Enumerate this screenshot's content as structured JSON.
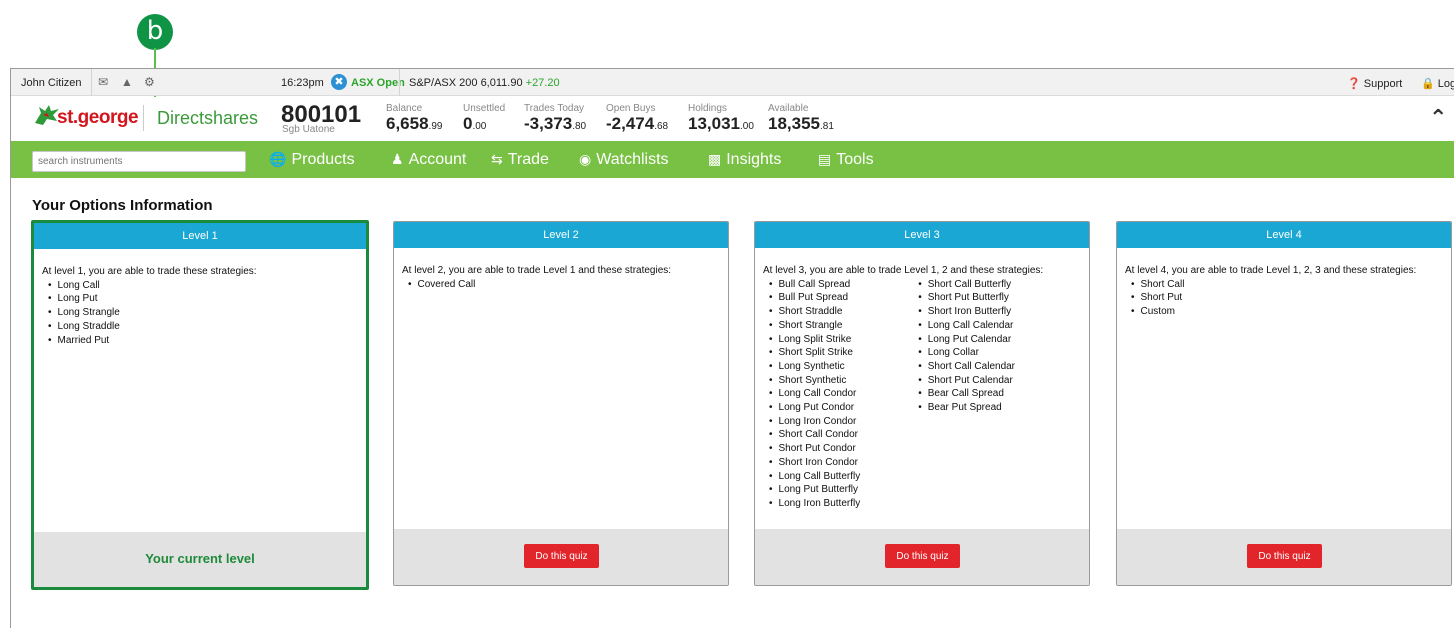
{
  "callout": {
    "label": "b"
  },
  "statusbar": {
    "user": "John Citizen",
    "time": "16:23pm",
    "market_status": "ASX Open",
    "index_name": "S&P/ASX 200",
    "index_value": "6,011.90",
    "index_change": "+27.20",
    "support": "Support",
    "logout": "Log out"
  },
  "header": {
    "brand": "st.george",
    "product": "Directshares",
    "account_number": "800101",
    "account_name": "Sgb Uatone",
    "stats": [
      {
        "label": "Balance",
        "value": "6,658",
        "dec": ".99"
      },
      {
        "label": "Unsettled",
        "value": "0",
        "dec": ".00"
      },
      {
        "label": "Trades Today",
        "value": "-3,373",
        "dec": ".80"
      },
      {
        "label": "Open Buys",
        "value": "-2,474",
        "dec": ".68"
      },
      {
        "label": "Holdings",
        "value": "13,031",
        "dec": ".00"
      },
      {
        "label": "Available",
        "value": "18,355",
        "dec": ".81"
      }
    ]
  },
  "nav": {
    "search_placeholder": "search instruments",
    "items": [
      {
        "label": "Products",
        "icon": "globe-icon"
      },
      {
        "label": "Account",
        "icon": "user-icon"
      },
      {
        "label": "Trade",
        "icon": "retweet-icon"
      },
      {
        "label": "Watchlists",
        "icon": "binoculars-icon"
      },
      {
        "label": "Insights",
        "icon": "monitor-icon"
      },
      {
        "label": "Tools",
        "icon": "bar-chart-icon"
      }
    ]
  },
  "page": {
    "title": "Your Options Information"
  },
  "levels": [
    {
      "title": "Level 1",
      "intro": "At level 1, you are able to trade these strategies:",
      "col1": [
        "Long Call",
        "Long Put",
        "Long Strangle",
        "Long Straddle",
        "Married Put"
      ],
      "col2": [],
      "footer": "Your current level"
    },
    {
      "title": "Level 2",
      "intro": "At level 2, you are able to trade Level 1 and these strategies:",
      "col1": [
        "Covered Call"
      ],
      "col2": [],
      "button": "Do this quiz"
    },
    {
      "title": "Level 3",
      "intro": "At level 3, you are able to trade Level 1, 2 and these strategies:",
      "col1": [
        "Bull Call Spread",
        "Bull Put Spread",
        "Short Straddle",
        "Short Strangle",
        "Long Split Strike",
        "Short Split Strike",
        "Long Synthetic",
        "Short Synthetic",
        "Long Call Condor",
        "Long Put Condor",
        "Long Iron Condor",
        "Short Call Condor",
        "Short Put Condor",
        "Short Iron Condor",
        "Long Call Butterfly",
        "Long Put Butterfly",
        "Long Iron Butterfly"
      ],
      "col2": [
        "Short Call Butterfly",
        "Short Put Butterfly",
        "Short Iron Butterfly",
        "Long Call Calendar",
        "Long Put Calendar",
        "Long Collar",
        "Short Call Calendar",
        "Short Put Calendar",
        "Bear Call Spread",
        "Bear Put Spread"
      ],
      "button": "Do this quiz"
    },
    {
      "title": "Level 4",
      "intro": "At level 4, you are able to trade Level 1, 2, 3 and these strategies:",
      "col1": [
        "Short Call",
        "Short Put",
        "Custom"
      ],
      "col2": [],
      "button": "Do this quiz"
    }
  ],
  "colors": {
    "nav_green": "#79c144",
    "header_blue": "#1ba7d3",
    "quiz_red": "#e2252b",
    "current_green": "#1a8a3d"
  }
}
